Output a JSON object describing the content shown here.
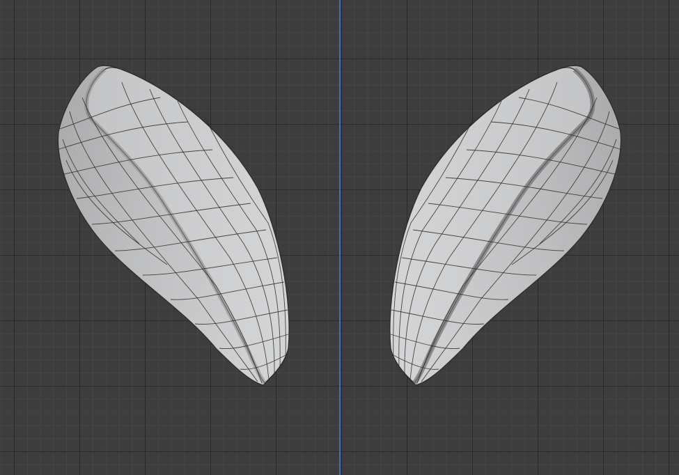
{
  "viewport": {
    "background_color": "#3d3d3d",
    "grid_major_color": "#2a2a2a",
    "grid_minor_color": "#474747",
    "axis_color": "#3f6fb3"
  },
  "objects": [
    {
      "name": "left-ear-mesh",
      "material_color": "#c8c9cb",
      "wire_color": "#2b2b2b"
    },
    {
      "name": "right-ear-mesh",
      "material_color": "#c8c9cb",
      "wire_color": "#2b2b2b"
    }
  ]
}
